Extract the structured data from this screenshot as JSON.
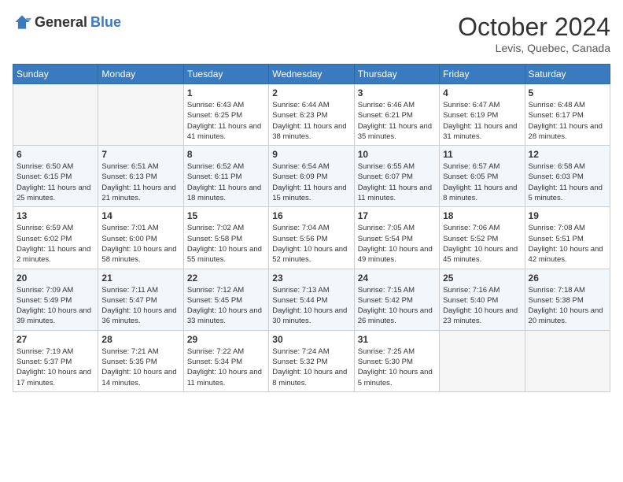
{
  "header": {
    "logo_general": "General",
    "logo_blue": "Blue",
    "month": "October 2024",
    "location": "Levis, Quebec, Canada"
  },
  "weekdays": [
    "Sunday",
    "Monday",
    "Tuesday",
    "Wednesday",
    "Thursday",
    "Friday",
    "Saturday"
  ],
  "weeks": [
    [
      {
        "day": "",
        "sunrise": "",
        "sunset": "",
        "daylight": ""
      },
      {
        "day": "",
        "sunrise": "",
        "sunset": "",
        "daylight": ""
      },
      {
        "day": "1",
        "sunrise": "Sunrise: 6:43 AM",
        "sunset": "Sunset: 6:25 PM",
        "daylight": "Daylight: 11 hours and 41 minutes."
      },
      {
        "day": "2",
        "sunrise": "Sunrise: 6:44 AM",
        "sunset": "Sunset: 6:23 PM",
        "daylight": "Daylight: 11 hours and 38 minutes."
      },
      {
        "day": "3",
        "sunrise": "Sunrise: 6:46 AM",
        "sunset": "Sunset: 6:21 PM",
        "daylight": "Daylight: 11 hours and 35 minutes."
      },
      {
        "day": "4",
        "sunrise": "Sunrise: 6:47 AM",
        "sunset": "Sunset: 6:19 PM",
        "daylight": "Daylight: 11 hours and 31 minutes."
      },
      {
        "day": "5",
        "sunrise": "Sunrise: 6:48 AM",
        "sunset": "Sunset: 6:17 PM",
        "daylight": "Daylight: 11 hours and 28 minutes."
      }
    ],
    [
      {
        "day": "6",
        "sunrise": "Sunrise: 6:50 AM",
        "sunset": "Sunset: 6:15 PM",
        "daylight": "Daylight: 11 hours and 25 minutes."
      },
      {
        "day": "7",
        "sunrise": "Sunrise: 6:51 AM",
        "sunset": "Sunset: 6:13 PM",
        "daylight": "Daylight: 11 hours and 21 minutes."
      },
      {
        "day": "8",
        "sunrise": "Sunrise: 6:52 AM",
        "sunset": "Sunset: 6:11 PM",
        "daylight": "Daylight: 11 hours and 18 minutes."
      },
      {
        "day": "9",
        "sunrise": "Sunrise: 6:54 AM",
        "sunset": "Sunset: 6:09 PM",
        "daylight": "Daylight: 11 hours and 15 minutes."
      },
      {
        "day": "10",
        "sunrise": "Sunrise: 6:55 AM",
        "sunset": "Sunset: 6:07 PM",
        "daylight": "Daylight: 11 hours and 11 minutes."
      },
      {
        "day": "11",
        "sunrise": "Sunrise: 6:57 AM",
        "sunset": "Sunset: 6:05 PM",
        "daylight": "Daylight: 11 hours and 8 minutes."
      },
      {
        "day": "12",
        "sunrise": "Sunrise: 6:58 AM",
        "sunset": "Sunset: 6:03 PM",
        "daylight": "Daylight: 11 hours and 5 minutes."
      }
    ],
    [
      {
        "day": "13",
        "sunrise": "Sunrise: 6:59 AM",
        "sunset": "Sunset: 6:02 PM",
        "daylight": "Daylight: 11 hours and 2 minutes."
      },
      {
        "day": "14",
        "sunrise": "Sunrise: 7:01 AM",
        "sunset": "Sunset: 6:00 PM",
        "daylight": "Daylight: 10 hours and 58 minutes."
      },
      {
        "day": "15",
        "sunrise": "Sunrise: 7:02 AM",
        "sunset": "Sunset: 5:58 PM",
        "daylight": "Daylight: 10 hours and 55 minutes."
      },
      {
        "day": "16",
        "sunrise": "Sunrise: 7:04 AM",
        "sunset": "Sunset: 5:56 PM",
        "daylight": "Daylight: 10 hours and 52 minutes."
      },
      {
        "day": "17",
        "sunrise": "Sunrise: 7:05 AM",
        "sunset": "Sunset: 5:54 PM",
        "daylight": "Daylight: 10 hours and 49 minutes."
      },
      {
        "day": "18",
        "sunrise": "Sunrise: 7:06 AM",
        "sunset": "Sunset: 5:52 PM",
        "daylight": "Daylight: 10 hours and 45 minutes."
      },
      {
        "day": "19",
        "sunrise": "Sunrise: 7:08 AM",
        "sunset": "Sunset: 5:51 PM",
        "daylight": "Daylight: 10 hours and 42 minutes."
      }
    ],
    [
      {
        "day": "20",
        "sunrise": "Sunrise: 7:09 AM",
        "sunset": "Sunset: 5:49 PM",
        "daylight": "Daylight: 10 hours and 39 minutes."
      },
      {
        "day": "21",
        "sunrise": "Sunrise: 7:11 AM",
        "sunset": "Sunset: 5:47 PM",
        "daylight": "Daylight: 10 hours and 36 minutes."
      },
      {
        "day": "22",
        "sunrise": "Sunrise: 7:12 AM",
        "sunset": "Sunset: 5:45 PM",
        "daylight": "Daylight: 10 hours and 33 minutes."
      },
      {
        "day": "23",
        "sunrise": "Sunrise: 7:13 AM",
        "sunset": "Sunset: 5:44 PM",
        "daylight": "Daylight: 10 hours and 30 minutes."
      },
      {
        "day": "24",
        "sunrise": "Sunrise: 7:15 AM",
        "sunset": "Sunset: 5:42 PM",
        "daylight": "Daylight: 10 hours and 26 minutes."
      },
      {
        "day": "25",
        "sunrise": "Sunrise: 7:16 AM",
        "sunset": "Sunset: 5:40 PM",
        "daylight": "Daylight: 10 hours and 23 minutes."
      },
      {
        "day": "26",
        "sunrise": "Sunrise: 7:18 AM",
        "sunset": "Sunset: 5:38 PM",
        "daylight": "Daylight: 10 hours and 20 minutes."
      }
    ],
    [
      {
        "day": "27",
        "sunrise": "Sunrise: 7:19 AM",
        "sunset": "Sunset: 5:37 PM",
        "daylight": "Daylight: 10 hours and 17 minutes."
      },
      {
        "day": "28",
        "sunrise": "Sunrise: 7:21 AM",
        "sunset": "Sunset: 5:35 PM",
        "daylight": "Daylight: 10 hours and 14 minutes."
      },
      {
        "day": "29",
        "sunrise": "Sunrise: 7:22 AM",
        "sunset": "Sunset: 5:34 PM",
        "daylight": "Daylight: 10 hours and 11 minutes."
      },
      {
        "day": "30",
        "sunrise": "Sunrise: 7:24 AM",
        "sunset": "Sunset: 5:32 PM",
        "daylight": "Daylight: 10 hours and 8 minutes."
      },
      {
        "day": "31",
        "sunrise": "Sunrise: 7:25 AM",
        "sunset": "Sunset: 5:30 PM",
        "daylight": "Daylight: 10 hours and 5 minutes."
      },
      {
        "day": "",
        "sunrise": "",
        "sunset": "",
        "daylight": ""
      },
      {
        "day": "",
        "sunrise": "",
        "sunset": "",
        "daylight": ""
      }
    ]
  ]
}
